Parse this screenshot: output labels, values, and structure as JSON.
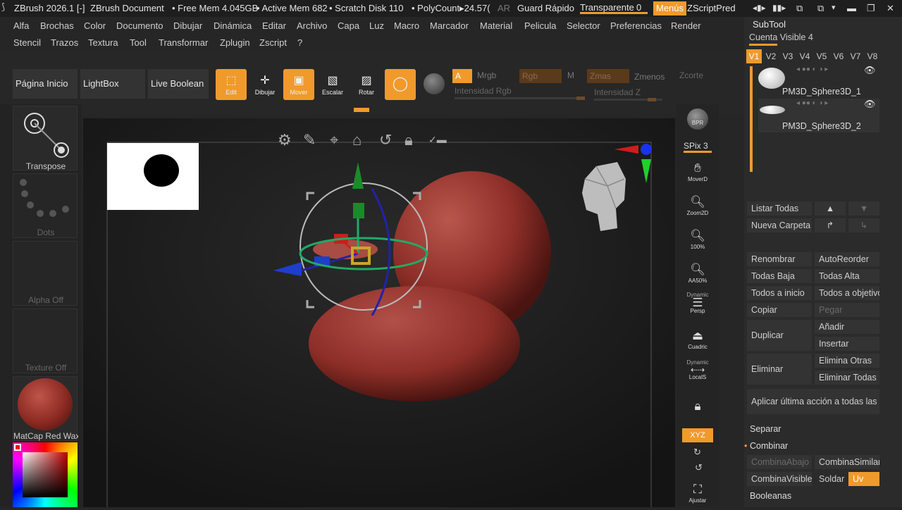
{
  "titlebar": {
    "app_title": "ZBrush 2026.1 [-]",
    "document": "ZBrush Document",
    "free_mem": "• Free Mem 4.045GB",
    "active_mem": "• Active Mem 682",
    "scratch": "• Scratch Disk 110",
    "polycount": "• PolyCount▸24.57(",
    "ar": "AR",
    "quicksave": "Guard Rápido",
    "transparent": "Transparente",
    "transparent_value": "0",
    "menus": "Menús",
    "zscript": "ZScriptPred"
  },
  "menubar": {
    "row1": [
      "Alfa",
      "Brochas",
      "Color",
      "Documento",
      "Dibujar",
      "Dinámica",
      "Editar",
      "Archivo",
      "Capa",
      "Luz",
      "Macro",
      "Marcador",
      "Material",
      "Pelicula",
      "Selector",
      "Preferencias",
      "Render"
    ],
    "row2": [
      "Stencil",
      "Trazos",
      "Textura",
      "Tool",
      "Transformar",
      "Zplugin",
      "Zscript",
      "?"
    ]
  },
  "toolbar": {
    "home": "Página Inicio",
    "lightbox": "LightBox",
    "live_boolean": "Live Boolean",
    "edit": "Edit",
    "draw": "Dibujar",
    "move": "Mover",
    "scale": "Escalar",
    "rotate": "Rotar",
    "a_label": "A",
    "mrgb": "Mrgb",
    "rgb": "Rgb",
    "m": "M",
    "zadd": "Zmas",
    "zsub": "Zmenos",
    "zcut": "Zcorte",
    "rgb_intensity": "Intensidad Rgb",
    "z_intensity": "Intensidad Z"
  },
  "leftpanel": {
    "transpose": "Transpose",
    "dots": "Dots",
    "alpha": "Alpha Off",
    "texture": "Texture Off",
    "matcap": "MatCap Red Wax",
    "matcap_color": "#8c2a22"
  },
  "rightstrip": {
    "bpr": "BPR",
    "spix": "SPix 3",
    "move": "MoverD",
    "zoom2d": "Zoom2D",
    "p100": "100%",
    "aa50": "AA50%",
    "dynamic": "Dynamic",
    "persp": "Persp",
    "floor": "Cuadric",
    "dynamic2": "Dynamic",
    "local": "LocalS",
    "xyz": "XYZ",
    "fit": "Ajustar"
  },
  "subtool": {
    "title": "SubTool",
    "visible_count": "Cuenta Visible 4",
    "versions": [
      "V1",
      "V2",
      "V3",
      "V4",
      "V5",
      "V6",
      "V7",
      "V8"
    ],
    "items": [
      {
        "name": "PM3D_Sphere3D_1"
      },
      {
        "name": "PM3D_Sphere3D_2"
      }
    ],
    "list_all": "Listar Todas",
    "new_folder": "Nueva Carpeta",
    "rename": "Renombrar",
    "autoreorder": "AutoReorder",
    "all_low": "Todas Baja",
    "all_high": "Todas Alta",
    "all_start": "Todos a inicio",
    "all_target": "Todos a objetivo",
    "copy": "Copiar",
    "paste": "Pegar",
    "duplicate": "Duplicar",
    "add": "Añadir",
    "insert": "Insertar",
    "delete": "Eliminar",
    "delete_others": "Elimina Otras",
    "delete_all": "Eliminar Todas",
    "apply_last": "Aplicar última acción a todas las l",
    "split": "Separar",
    "merge": "Combinar",
    "merge_down": "CombinaAbajo",
    "merge_similar": "CombinaSimilar",
    "merge_visible": "CombinaVisible",
    "weld": "Soldar",
    "uv": "Uv",
    "boolean": "Booleanas"
  },
  "colors": {
    "accent": "#f09a2c",
    "model": "#8e2e28"
  }
}
